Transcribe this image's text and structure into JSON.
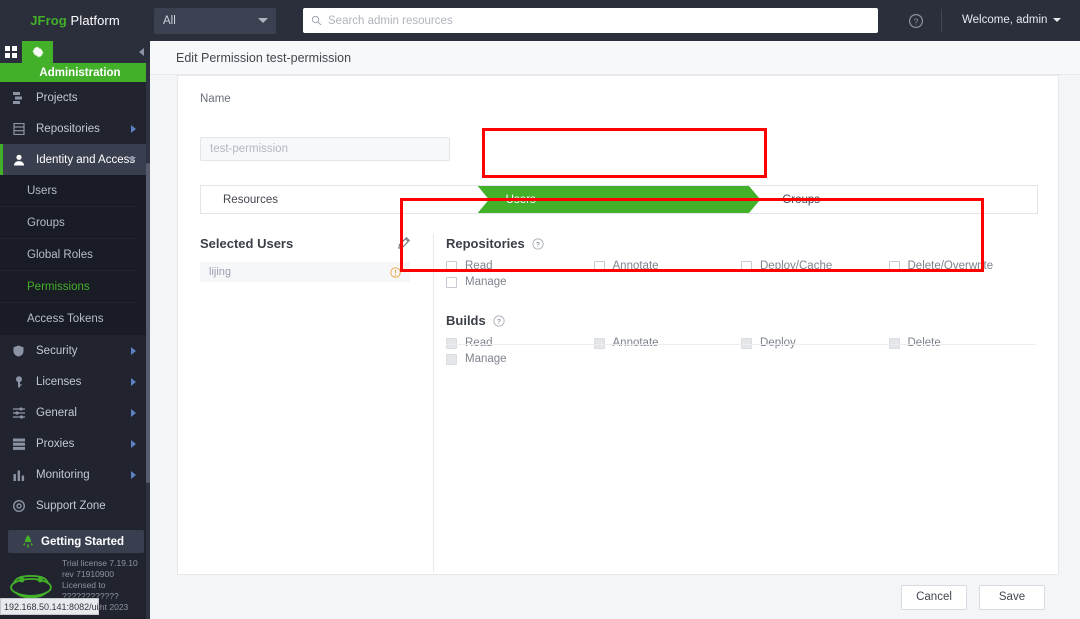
{
  "topbar": {
    "brand_jfrog": "JFrog",
    "brand_platform": " Platform",
    "scope_label": "All",
    "search_placeholder": "Search admin resources",
    "search_value": "",
    "welcome": "Welcome, admin",
    "help_icon": "help-circle-icon",
    "search_icon": "search-icon",
    "caret_icon": "chevron-down-icon"
  },
  "sidebar": {
    "grid_icon": "grid-apps-icon",
    "gear_icon": "gear-icon",
    "collapse_icon": "chevron-left-icon",
    "admin_header": "Administration",
    "items": [
      {
        "label": "Projects",
        "icon": "projects-icon",
        "arrow": "none"
      },
      {
        "label": "Repositories",
        "icon": "repository-icon",
        "arrow": "right"
      },
      {
        "label": "Identity and Access",
        "icon": "user-icon",
        "arrow": "down"
      },
      {
        "label": "Security",
        "icon": "shield-icon",
        "arrow": "right"
      },
      {
        "label": "Licenses",
        "icon": "key-icon",
        "arrow": "right"
      },
      {
        "label": "General",
        "icon": "sliders-icon",
        "arrow": "right"
      },
      {
        "label": "Proxies",
        "icon": "server-icon",
        "arrow": "right"
      },
      {
        "label": "Monitoring",
        "icon": "bar-chart-icon",
        "arrow": "right"
      },
      {
        "label": "Support Zone",
        "icon": "lifebuoy-icon",
        "arrow": "none"
      }
    ],
    "subitems": [
      {
        "label": "Users",
        "selected": false
      },
      {
        "label": "Groups",
        "selected": false
      },
      {
        "label": "Global Roles",
        "selected": false
      },
      {
        "label": "Permissions",
        "selected": true
      },
      {
        "label": "Access Tokens",
        "selected": false
      }
    ],
    "getting_started": "Getting Started",
    "getting_started_icon": "rocket-icon",
    "logo_icon": "jfrog-frog-logo",
    "license_lines": [
      "Trial license 7.19.10",
      "rev 71910900",
      "Licensed to",
      "????????????",
      "© Copyright 2023"
    ],
    "status_url": "192.168.50.141:8082/ui/"
  },
  "main": {
    "page_title": "Edit Permission test-permission",
    "name_label": "Name",
    "name_placeholder": "test-permission",
    "name_value": "",
    "tabs": [
      {
        "label": "Resources",
        "active": false
      },
      {
        "label": "Users",
        "active": true
      },
      {
        "label": "Groups",
        "active": false
      }
    ],
    "selected_users": {
      "title": "Selected Users",
      "edit_icon": "pencil-icon",
      "rows": [
        {
          "name": "lijing",
          "status_icon": "warning-circle-icon"
        }
      ]
    },
    "permission_groups": [
      {
        "title": "Repositories",
        "help_icon": "help-circle-icon",
        "disabled": false,
        "checkboxes": [
          {
            "label": "Read",
            "checked": false
          },
          {
            "label": "Annotate",
            "checked": false
          },
          {
            "label": "Deploy/Cache",
            "checked": false
          },
          {
            "label": "Delete/Overwrite",
            "checked": false
          },
          {
            "label": "Manage",
            "checked": false
          }
        ]
      },
      {
        "title": "Builds",
        "help_icon": "help-circle-icon",
        "disabled": true,
        "checkboxes": [
          {
            "label": "Read",
            "checked": false
          },
          {
            "label": "Annotate",
            "checked": false
          },
          {
            "label": "Deploy",
            "checked": false
          },
          {
            "label": "Delete",
            "checked": false
          },
          {
            "label": "Manage",
            "checked": false
          }
        ]
      }
    ],
    "footer": {
      "cancel_label": "Cancel",
      "save_label": "Save"
    }
  },
  "annotations": {
    "highlight_color": "#ff0000",
    "boxes": [
      {
        "target": "users-tab"
      },
      {
        "target": "repositories-permissions"
      }
    ]
  },
  "colors": {
    "brand_green": "#43b02a",
    "topbar_dark": "#2b2f3c",
    "sidebar_dark": "#21242e",
    "warning_orange": "#e8a33d"
  }
}
